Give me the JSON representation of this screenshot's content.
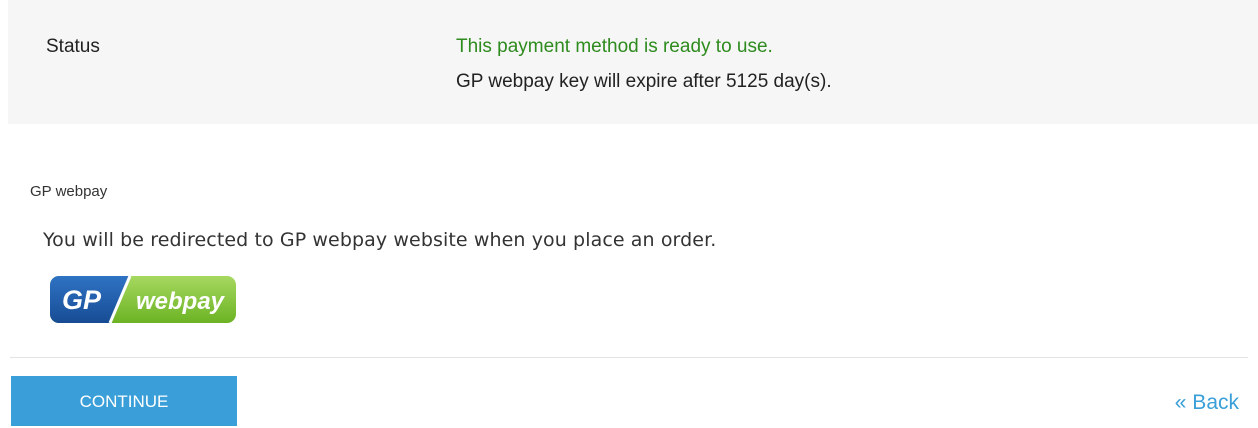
{
  "status": {
    "label": "Status",
    "ready_text": "This payment method is ready to use.",
    "expire_text": "GP webpay key will expire after 5125 day(s)."
  },
  "method": {
    "title": "GP webpay",
    "description": "You will be redirected to GP webpay website when you place an order.",
    "logo": {
      "left_text": "GP",
      "right_text": "webpay",
      "blue": "#1d5aa8",
      "green": "#7dc22e"
    }
  },
  "actions": {
    "continue_label": "CONTINUE",
    "back_label": "« Back"
  },
  "colors": {
    "accent": "#3a9fd8",
    "success": "#2e8b1e"
  }
}
